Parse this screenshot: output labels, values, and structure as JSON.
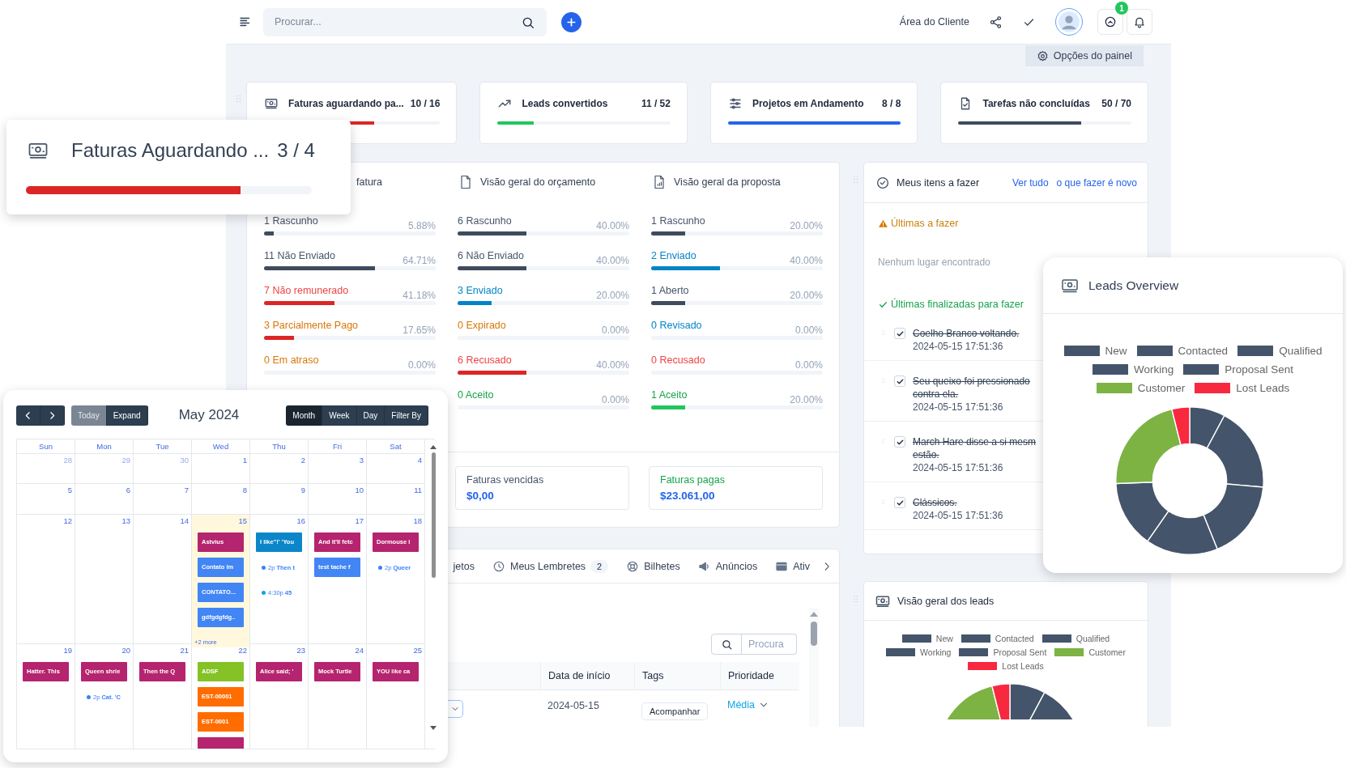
{
  "header": {
    "search": {
      "placeholder": "Procurar..."
    },
    "client_area": "Área do Cliente",
    "notification_count": "1"
  },
  "dashboard_options": "Opções do painel",
  "stats": [
    {
      "title": "Faturas aguardando pa...",
      "count": "10 / 16",
      "level": 0.625,
      "color": "#dc2626"
    },
    {
      "title": "Leads convertidos",
      "count": "11 / 52",
      "level": 0.21,
      "color": "#22c55e"
    },
    {
      "title": "Projetos em Andamento",
      "count": "8 / 8",
      "level": 1,
      "color": "#2563eb"
    },
    {
      "title": "Tarefas não concluídas",
      "count": "50 / 70",
      "level": 0.71,
      "color": "#3f4b5e"
    }
  ],
  "overview": {
    "columns": [
      {
        "title": "fatura",
        "rows": [
          {
            "label": "1 Rascunho",
            "pct": "5.88%",
            "color": "#475569",
            "bar": {
              "level": 0.0588,
              "color": "#3f4b5e"
            }
          },
          {
            "label": "11 Não Enviado",
            "pct": "64.71%",
            "color": "#475569",
            "bar": {
              "level": 0.6471,
              "color": "#3f4b5e"
            }
          },
          {
            "label": "7 Não remunerado",
            "pct": "41.18%",
            "color": "#ef4444",
            "bar": {
              "level": 0.4118,
              "color": "#dc2626"
            }
          },
          {
            "label": "3 Parcialmente Pago",
            "pct": "17.65%",
            "color": "#d97706",
            "bar": {
              "level": 0.1765,
              "color": "#dc2626"
            }
          },
          {
            "label": "0 Em atraso",
            "pct": "0.00%",
            "color": "#d97706"
          }
        ]
      },
      {
        "title": "Visão geral do orçamento",
        "rows": [
          {
            "label": "6 Rascunho",
            "pct": "40.00%",
            "color": "#475569",
            "bar": {
              "level": 0.4,
              "color": "#3f4b5e"
            }
          },
          {
            "label": "6 Não Enviado",
            "pct": "40.00%",
            "color": "#475569",
            "bar": {
              "level": 0.4,
              "color": "#3f4b5e"
            }
          },
          {
            "label": "3 Enviado",
            "pct": "20.00%",
            "color": "#0284c7",
            "bar": {
              "level": 0.2,
              "color": "#0284c7"
            }
          },
          {
            "label": "0 Expirado",
            "pct": "0.00%",
            "color": "#d97706"
          },
          {
            "label": "6 Recusado",
            "pct": "40.00%",
            "color": "#ef4444",
            "bar": {
              "level": 0.4,
              "color": "#dc2626"
            }
          },
          {
            "label": "0 Aceito",
            "pct": "0.00%",
            "color": "#16a34a"
          }
        ]
      },
      {
        "title": "Visão geral da proposta",
        "rows": [
          {
            "label": "1 Rascunho",
            "pct": "20.00%",
            "color": "#475569",
            "bar": {
              "level": 0.2,
              "color": "#3f4b5e"
            }
          },
          {
            "label": "2 Enviado",
            "pct": "40.00%",
            "color": "#0284c7",
            "bar": {
              "level": 0.4,
              "color": "#0284c7"
            }
          },
          {
            "label": "1 Aberto",
            "pct": "20.00%",
            "color": "#475569",
            "bar": {
              "level": 0.2,
              "color": "#3f4b5e"
            }
          },
          {
            "label": "0 Revisado",
            "pct": "0.00%",
            "color": "#0284c7"
          },
          {
            "label": "0 Recusado",
            "pct": "0.00%",
            "color": "#ef4444"
          },
          {
            "label": "1 Aceito",
            "pct": "20.00%",
            "color": "#16a34a",
            "bar": {
              "level": 0.2,
              "color": "#22c55e"
            }
          }
        ]
      }
    ],
    "totals": [
      {
        "label": "Faturas vencidas",
        "value": "$0,00",
        "color": "#475569"
      },
      {
        "label": "Faturas pagas",
        "value": "$23.061,00",
        "color": "#16a34a"
      }
    ]
  },
  "tabs_panel": {
    "tabs": [
      {
        "label": "jetos"
      },
      {
        "label": "Meus Lembretes",
        "badge": "2"
      },
      {
        "label": "Bilhetes"
      },
      {
        "label": "Anúncios"
      },
      {
        "label": "Ativ"
      }
    ],
    "search": {
      "placeholder": "Procura"
    },
    "table": {
      "columns": [
        "Data de início",
        "Tags",
        "Prioridade"
      ],
      "rows": [
        {
          "start": "2024-05-15",
          "tag": "Acompanhar",
          "priority": "Média"
        }
      ]
    }
  },
  "todo": {
    "title": "Meus itens a fazer",
    "links": [
      "Ver tudo",
      "o que fazer é novo"
    ],
    "pending_title": "Últimas a fazer",
    "empty": "Nenhum lugar encontrado",
    "done_title": "Últimas finalizadas para fazer",
    "items": [
      {
        "lines": [
          "Coelho Branco voltando."
        ],
        "date": "2024-05-15 17:51:36",
        "checked": true
      },
      {
        "lines": [
          "Seu queixo foi pressionado",
          "contra ela."
        ],
        "date": "2024-05-15 17:51:36",
        "checked": true
      },
      {
        "lines": [
          "March Hare disse a si mesm",
          "estão."
        ],
        "date": "2024-05-15 17:51:36",
        "checked": true
      },
      {
        "lines": [
          "Clássicos."
        ],
        "date": "2024-05-15 17:51:36",
        "checked": true
      }
    ]
  },
  "leads_widget": {
    "title": "Visão geral dos leads",
    "legend": [
      {
        "label": "New",
        "color": "#44546a"
      },
      {
        "label": "Contacted",
        "color": "#44546a"
      },
      {
        "label": "Qualified",
        "color": "#44546a"
      },
      {
        "label": "Working",
        "color": "#44546a"
      },
      {
        "label": "Proposal Sent",
        "color": "#44546a"
      },
      {
        "label": "Customer",
        "color": "#7cb342"
      },
      {
        "label": "Lost Leads",
        "color": "#f8283f"
      }
    ]
  },
  "floating_invoice_card": {
    "title": "Faturas Aguardando ...",
    "count": "3 / 4",
    "level": 0.75,
    "color": "#dc2626"
  },
  "calendar": {
    "today": {
      "label": "Today",
      "disabled": true
    },
    "expand": "Expand",
    "title": "May 2024",
    "views": [
      {
        "label": "Month",
        "selected": true
      },
      {
        "label": "Week",
        "selected": false
      },
      {
        "label": "Day",
        "selected": false
      },
      {
        "label": "Filter By",
        "selected": false
      }
    ],
    "weekdays": [
      "Sun",
      "Mon",
      "Tue",
      "Wed",
      "Thu",
      "Fri",
      "Sat"
    ],
    "weeks": [
      [
        {
          "day": "28",
          "muted": true
        },
        {
          "day": "29",
          "muted": true
        },
        {
          "day": "30",
          "muted": true
        },
        {
          "day": "1",
          "muted": false
        },
        {
          "day": "2",
          "muted": false
        },
        {
          "day": "3",
          "muted": false
        },
        {
          "day": "4",
          "muted": false
        }
      ],
      [
        {
          "day": "5",
          "muted": false
        },
        {
          "day": "6",
          "muted": false
        },
        {
          "day": "7",
          "muted": false
        },
        {
          "day": "8",
          "muted": false
        },
        {
          "day": "9",
          "muted": false
        },
        {
          "day": "10",
          "muted": false
        },
        {
          "day": "11",
          "muted": false
        }
      ],
      [
        {
          "day": "12",
          "muted": false
        },
        {
          "day": "13",
          "muted": false
        },
        {
          "day": "14",
          "muted": false
        },
        {
          "day": "15",
          "muted": false,
          "today": true,
          "events": [
            {
              "kind": "block",
              "text": "Astvius",
              "color": "#b5246e"
            },
            {
              "kind": "block",
              "text": "Contato Im",
              "color": "#4285f4"
            },
            {
              "kind": "block",
              "text": "CONTATO...",
              "color": "#4285f4"
            },
            {
              "kind": "block",
              "text": "gdfgdgfdg..",
              "color": "#4285f4"
            },
            {
              "kind": "more",
              "text": "+2 more"
            }
          ]
        },
        {
          "day": "16",
          "muted": false,
          "events": [
            {
              "kind": "block",
              "text": "I like\"!' 'You",
              "color": "#0b86c8"
            },
            {
              "kind": "dot",
              "time": "2p",
              "text": "Then t",
              "color": "#3b82f6"
            },
            {
              "kind": "dot",
              "time": "4:30p",
              "text": "45",
              "color": "#0ea5e9"
            }
          ]
        },
        {
          "day": "17",
          "muted": false,
          "events": [
            {
              "kind": "block",
              "text": "And it'll fetc",
              "color": "#b5246e"
            },
            {
              "kind": "block",
              "text": "test tache f",
              "color": "#4285f4"
            }
          ]
        },
        {
          "day": "18",
          "muted": false,
          "events": [
            {
              "kind": "block",
              "text": "Dormouse i",
              "color": "#b5246e"
            },
            {
              "kind": "dot",
              "time": "2p",
              "text": "Queer",
              "color": "#3b82f6"
            }
          ]
        }
      ],
      [
        {
          "day": "19",
          "muted": false,
          "events": [
            {
              "kind": "block",
              "text": "Hatter. This",
              "color": "#b5246e"
            }
          ]
        },
        {
          "day": "20",
          "muted": false,
          "events": [
            {
              "kind": "block",
              "text": "Queen shrie",
              "color": "#b5246e"
            },
            {
              "kind": "dot",
              "time": "2p",
              "text": "Cat. 'C",
              "color": "#3b82f6"
            }
          ]
        },
        {
          "day": "21",
          "muted": false,
          "events": [
            {
              "kind": "block",
              "text": "Then the Q",
              "color": "#b5246e"
            }
          ]
        },
        {
          "day": "22",
          "muted": false,
          "events": [
            {
              "kind": "block",
              "text": "ADSF",
              "color": "#84c225"
            },
            {
              "kind": "block",
              "text": "EST-00001",
              "color": "#ff6d00"
            },
            {
              "kind": "block",
              "text": "EST-0001",
              "color": "#ff6d00"
            },
            {
              "kind": "block",
              "color": "#b5246e"
            }
          ]
        },
        {
          "day": "23",
          "muted": false,
          "events": [
            {
              "kind": "block",
              "text": "Alice said; '",
              "color": "#b5246e"
            }
          ]
        },
        {
          "day": "24",
          "muted": false,
          "events": [
            {
              "kind": "block",
              "text": "Mock Turtle",
              "color": "#b5246e"
            }
          ]
        },
        {
          "day": "25",
          "muted": false,
          "events": [
            {
              "kind": "block",
              "text": "YOU like ca",
              "color": "#b5246e"
            }
          ]
        }
      ]
    ]
  },
  "leads_overview": {
    "title": "Leads Overview",
    "legend": [
      {
        "label": "New",
        "color": "#44546a"
      },
      {
        "label": "Contacted",
        "color": "#44546a"
      },
      {
        "label": "Qualified",
        "color": "#44546a"
      },
      {
        "label": "Working",
        "color": "#44546a"
      },
      {
        "label": "Proposal Sent",
        "color": "#44546a"
      },
      {
        "label": "Customer",
        "color": "#7cb342"
      },
      {
        "label": "Lost Leads",
        "color": "#f8283f"
      }
    ]
  }
}
